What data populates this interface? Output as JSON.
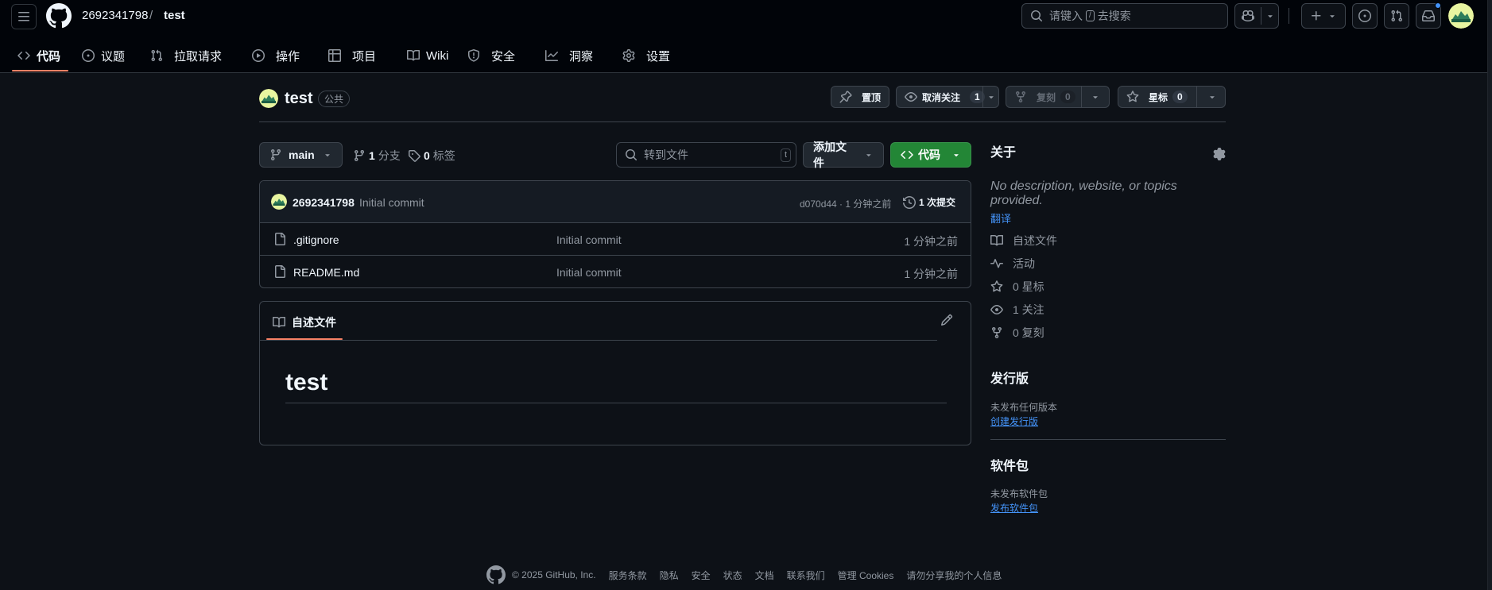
{
  "header": {
    "owner": "2692341798",
    "separator": "/",
    "repo": "test",
    "search_placeholder_a": "请键入",
    "search_kbd": "/",
    "search_placeholder_b": "去搜索"
  },
  "tabs": [
    {
      "label": "代码",
      "icon": "code-icon"
    },
    {
      "label": "议题",
      "icon": "issue-icon"
    },
    {
      "label": "拉取请求",
      "icon": "pull-request-icon"
    },
    {
      "label": "操作",
      "icon": "play-icon"
    },
    {
      "label": "项目",
      "icon": "table-icon"
    },
    {
      "label": "Wiki",
      "icon": "book-icon"
    },
    {
      "label": "安全",
      "icon": "shield-icon"
    },
    {
      "label": "洞察",
      "icon": "graph-icon"
    },
    {
      "label": "设置",
      "icon": "gear-icon"
    }
  ],
  "repo_header": {
    "name": "test",
    "visibility": "公共",
    "pin_label": "置顶",
    "unwatch_label": "取消关注",
    "watch_count": "1",
    "fork_label": "复刻",
    "fork_count": "0",
    "star_label": "星标",
    "star_count": "0"
  },
  "file_nav": {
    "branch": "main",
    "branches_count": "1",
    "branches_label": "分支",
    "tags_count": "0",
    "tags_label": "标签",
    "goto_placeholder": "转到文件",
    "goto_kbd": "t",
    "add_file_label": "添加文件",
    "code_label": "代码"
  },
  "commit": {
    "author": "2692341798",
    "message": "Initial commit",
    "meta": "d070d44 · 1 分钟之前",
    "history_label": "1 次提交"
  },
  "files": [
    {
      "name": ".gitignore",
      "message": "Initial commit",
      "time": "1 分钟之前"
    },
    {
      "name": "README.md",
      "message": "Initial commit",
      "time": "1 分钟之前"
    }
  ],
  "readme": {
    "tab_label": "自述文件",
    "heading": "test"
  },
  "sidebar": {
    "about_title": "关于",
    "description": "No description, website, or topics provided.",
    "translate": "翻译",
    "items": [
      {
        "label": "自述文件",
        "icon": "book-icon"
      },
      {
        "label": "活动",
        "icon": "pulse-icon"
      },
      {
        "label": "0 星标",
        "icon": "star-icon"
      },
      {
        "label": "1 关注",
        "icon": "eye-icon"
      },
      {
        "label": "0 复刻",
        "icon": "fork-icon"
      }
    ],
    "releases_title": "发行版",
    "releases_none": "未发布任何版本",
    "releases_link": "创建发行版",
    "packages_title": "软件包",
    "packages_none": "未发布软件包",
    "packages_link": "发布软件包"
  },
  "footer": {
    "copyright": "© 2025 GitHub, Inc.",
    "links": [
      "服务条款",
      "隐私",
      "安全",
      "状态",
      "文档",
      "联系我们",
      "管理 Cookies",
      "请勿分享我的个人信息"
    ]
  },
  "colors": {
    "accent": "#f78166",
    "link": "#4493f8",
    "primary_button": "#238636",
    "background": "#0d1117"
  }
}
